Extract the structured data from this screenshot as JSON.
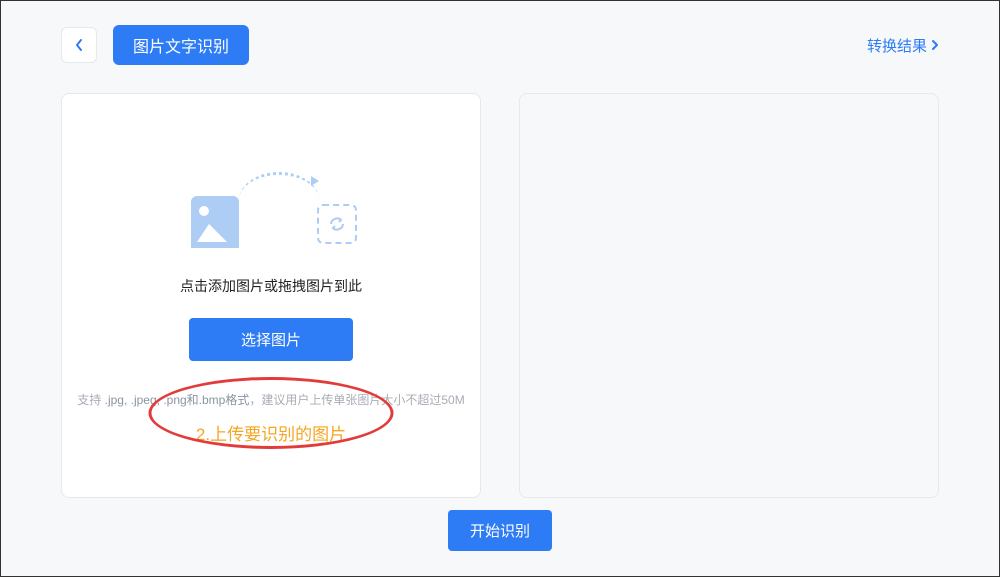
{
  "header": {
    "title": "图片文字识别",
    "results_link": "转换结果"
  },
  "upload": {
    "hint": "点击添加图片或拖拽图片到此",
    "select_button": "选择图片",
    "format_prefix": "支持 ",
    "format_highlight": ".jpg, .jpeg, .png和.bmp格式",
    "format_suffix": "，建议用户上传单张图片大小不超过50M",
    "step_label": "2.上传要识别的图片"
  },
  "action": {
    "start_button": "开始识别"
  }
}
